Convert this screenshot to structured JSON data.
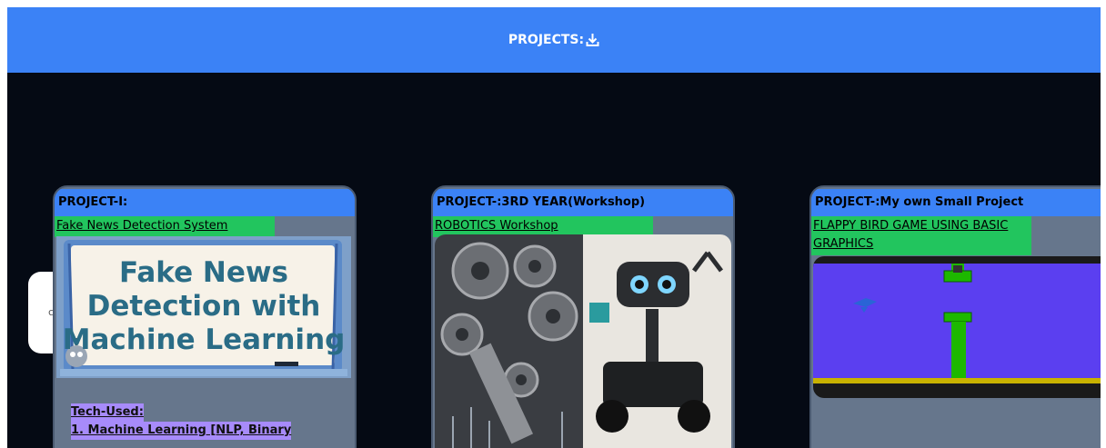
{
  "header": {
    "title": "PROJECTS:"
  },
  "projects": [
    {
      "title": "PROJECT-I:",
      "link": "Fake News Detection System",
      "image_text": [
        "Fake News",
        "Detection with",
        "Machine Learning"
      ],
      "tech_label": "Tech-Used:",
      "tech_item": "1. Machine Learning [NLP, Binary"
    },
    {
      "title": "PROJECT-:3RD YEAR(Workshop)",
      "link": "ROBOTICS Workshop"
    },
    {
      "title": "PROJECT-:My own Small Project",
      "link": "FLAPPY BIRD GAME USING BASIC GRAPHICS"
    }
  ],
  "colors": {
    "header_bg": "#3b82f6",
    "page_bg": "#050a14",
    "card_bg": "#66768c",
    "link_bg": "#22c55e",
    "tech_bg": "#a78bfa"
  },
  "icons": {
    "header": "download-icon"
  }
}
